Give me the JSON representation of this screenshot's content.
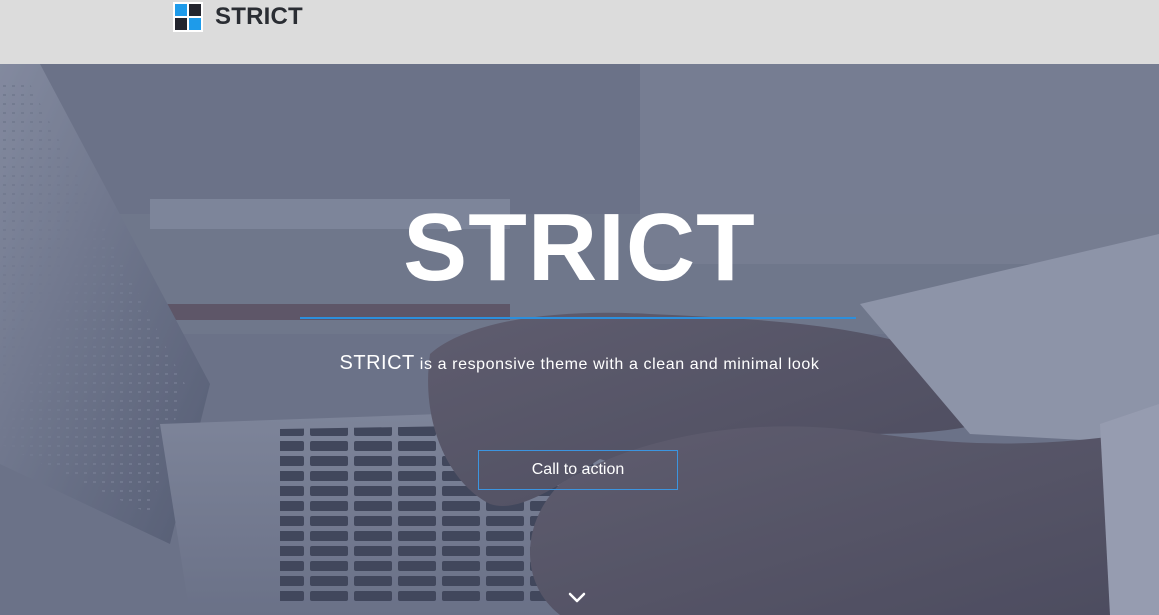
{
  "header": {
    "brand_name": "STRICT",
    "logo_colors": [
      "#1e9bea",
      "#23252e"
    ]
  },
  "hero": {
    "title": "STRICT",
    "accent_color": "#2d8fdc",
    "tagline_brand": "STRICT",
    "tagline_text": " is a responsive theme with a clean and minimal look",
    "cta_label": "Call to action",
    "scroll_icon": "chevron-down-icon"
  }
}
